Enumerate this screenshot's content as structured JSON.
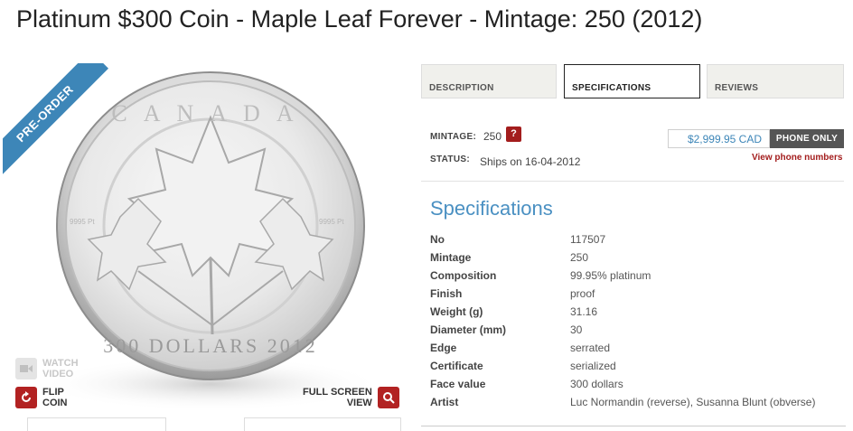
{
  "page": {
    "title": "Platinum $300 Coin - Maple Leaf Forever - Mintage: 250 (2012)"
  },
  "image": {
    "ribbon": "PRE-ORDER",
    "coin_top_text": "CANADA",
    "coin_bottom_text": "300 DOLLARS 2012",
    "purity_mark": "9995 Pt",
    "watch_video": {
      "line1": "WATCH",
      "line2": "VIDEO",
      "icon": "video-camera-icon"
    },
    "flip_coin": {
      "line1": "FLIP",
      "line2": "COIN",
      "icon": "rotate-icon"
    },
    "full_screen": {
      "line1": "FULL SCREEN",
      "line2": "VIEW",
      "icon": "zoom-icon"
    }
  },
  "tabs": [
    {
      "label": "DESCRIPTION",
      "active": false
    },
    {
      "label": "SPECIFICATIONS",
      "active": true
    },
    {
      "label": "REVIEWS",
      "active": false
    }
  ],
  "info": {
    "mintage_label": "MINTAGE:",
    "mintage_value": "250",
    "help": "?",
    "status_label": "STATUS:",
    "status_value": "Ships on 16-04-2012"
  },
  "purchase": {
    "price": "$2,999.95 CAD",
    "phone_button": "PHONE ONLY",
    "phone_link": "View phone numbers"
  },
  "specifications": {
    "heading": "Specifications",
    "rows": [
      {
        "key": "No",
        "value": "117507"
      },
      {
        "key": "Mintage",
        "value": "250"
      },
      {
        "key": "Composition",
        "value": "99.95% platinum"
      },
      {
        "key": "Finish",
        "value": "proof"
      },
      {
        "key": "Weight (g)",
        "value": "31.16"
      },
      {
        "key": "Diameter (mm)",
        "value": "30"
      },
      {
        "key": "Edge",
        "value": "serrated"
      },
      {
        "key": "Certificate",
        "value": "serialized"
      },
      {
        "key": "Face value",
        "value": "300 dollars"
      },
      {
        "key": "Artist",
        "value": "Luc Normandin (reverse), Susanna Blunt (obverse)"
      }
    ]
  },
  "colors": {
    "accent": "#4a90c2",
    "ribbon": "#3d86b8",
    "alert": "#a31d1d"
  }
}
